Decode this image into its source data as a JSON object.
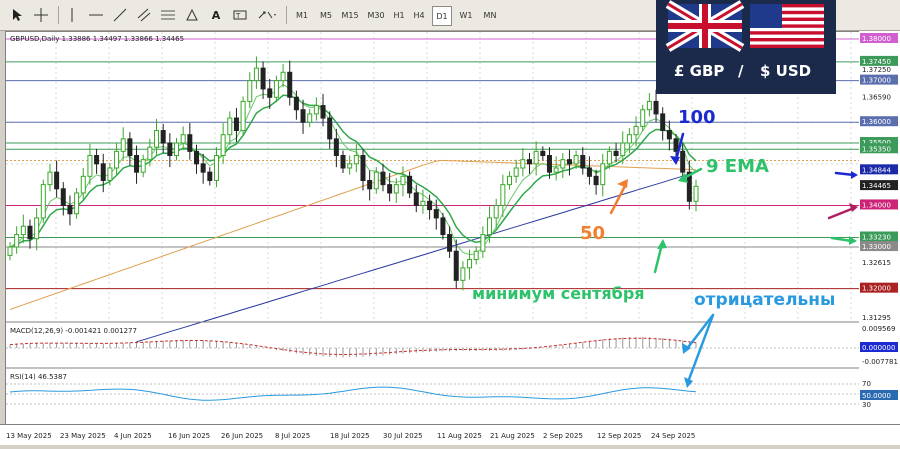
{
  "toolbar": {
    "timeframes": [
      "M1",
      "M5",
      "M15",
      "M30",
      "H1",
      "H4",
      "D1",
      "W1",
      "MN"
    ],
    "active_timeframe": "D1"
  },
  "chart": {
    "header": "GBPUSD,Daily  1.33886 1.34497 1.33866 1.34465",
    "price_labels": [
      "1.38000",
      "1.37450",
      "1.37250",
      "1.37000",
      "1.36590",
      "1.36000",
      "1.35500",
      "1.35350",
      "1.34844",
      "1.34465",
      "1.34000",
      "1.33230",
      "1.33000",
      "1.32615",
      "1.32000",
      "1.31295"
    ],
    "highlight_labels": [
      {
        "text": "1.38000",
        "color": "#d05fd0"
      },
      {
        "text": "1.37450",
        "color": "#3c9a5a"
      },
      {
        "text": "1.37000",
        "color": "#5b6fae"
      },
      {
        "text": "1.36000",
        "color": "#5b6fae"
      },
      {
        "text": "1.35500",
        "color": "#3c9a5a"
      },
      {
        "text": "1.35350",
        "color": "#3c9a5a"
      },
      {
        "text": "1.34844",
        "color": "#1a2aa8"
      },
      {
        "text": "1.34465",
        "color": "#222222"
      },
      {
        "text": "1.34000",
        "color": "#cc2277"
      },
      {
        "text": "1.33230",
        "color": "#3c9a5a"
      },
      {
        "text": "1.33000",
        "color": "#8a8a8a"
      },
      {
        "text": "1.32000",
        "color": "#aa2222"
      }
    ],
    "date_labels": [
      "13 May 2025",
      "23 May 2025",
      "4 Jun 2025",
      "16 Jun 2025",
      "26 Jun 2025",
      "8 Jul 2025",
      "18 Jul 2025",
      "30 Jul 2025",
      "11 Aug 2025",
      "21 Aug 2025",
      "2 Sep 2025",
      "12 Sep 2025",
      "24 Sep 2025"
    ],
    "annotations": {
      "a100": "100",
      "ema9": "9 EMA",
      "a50": "50",
      "min_sept": "минимум сентября",
      "negative": "отрицательны"
    }
  },
  "macd": {
    "header": "MACD(12,26,9) -0.001421 0.001277",
    "labels": [
      "0.009569",
      "0.000000",
      "-0.007781"
    ]
  },
  "rsi": {
    "header": "RSI(14) 46.5387",
    "labels": [
      "70",
      "50.0000",
      "30"
    ]
  },
  "flags": {
    "gbp": "£ GBP",
    "slash": "/",
    "usd": "$ USD"
  },
  "colors": {
    "bull": "#3aa82a",
    "bear": "#222222",
    "ema9": "#2ea84a",
    "ma50": "#e0a050",
    "ma100": "#2838a0",
    "annotation_blue": "#1a2ad0",
    "annotation_green": "#2ec26a",
    "annotation_orange": "#f08030",
    "annotation_cyan": "#2a9ae0",
    "annotation_magenta": "#b02060"
  }
}
